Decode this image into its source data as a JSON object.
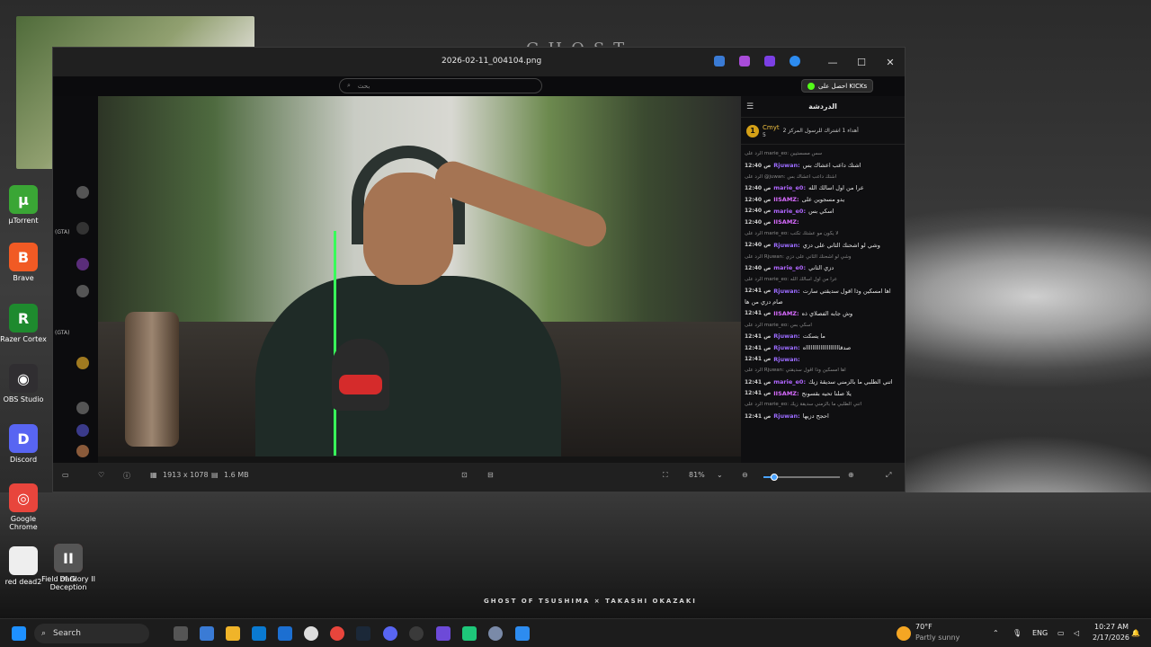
{
  "wallpaper": {
    "title": "GHOST",
    "credit": "GHOST OF TSUSHIMA × TAKASHI OKAZAKI"
  },
  "desktop_icons": [
    {
      "label": "µTorrent",
      "icon": "utorrent-icon",
      "color": "#3aa635",
      "glyph": "µ"
    },
    {
      "label": "Brave",
      "icon": "brave-icon",
      "color": "#f15a24",
      "glyph": "B"
    },
    {
      "label": "Razer Cortex",
      "icon": "razer-icon",
      "color": "#1e8a2e",
      "glyph": "R"
    },
    {
      "label": "OBS Studio",
      "icon": "obs-icon",
      "color": "#302e31",
      "glyph": "◉"
    },
    {
      "label": "Discord",
      "icon": "discord-icon",
      "color": "#5865f2",
      "glyph": "D"
    },
    {
      "label": "Google Chrome",
      "icon": "chrome-icon",
      "color": "#e8453c",
      "glyph": "◎"
    },
    {
      "label": "Dark Deception",
      "icon": "dark-deception-icon",
      "color": "#7a1010",
      "glyph": "☠"
    },
    {
      "label": "red dead2",
      "icon": "file-icon",
      "color": "#eeeeee",
      "glyph": ""
    },
    {
      "label": "Field of Glory II",
      "icon": "field-of-glory-icon",
      "color": "#555555",
      "glyph": "II"
    }
  ],
  "viewer": {
    "filename": "2026-02-11_004104.png",
    "dimensions": "1913 x 1078",
    "filesize": "1.6 MB",
    "zoom": "81%",
    "zoom_fraction": 0.14,
    "controls": {
      "minimize": "—",
      "maximize": "☐",
      "close": "✕"
    }
  },
  "stream": {
    "search_placeholder": "بحث",
    "kick_button": "احصل على KICKs",
    "sidebar_labels": [
      "(GTA)",
      "(GTA)"
    ]
  },
  "chat": {
    "title": "الدردشة",
    "pinned_user": "Cmyt",
    "pinned_count": "5",
    "pinned_badge": "1",
    "pinned_text": "أهداء 1 اشتراك للرسول المركز 2",
    "messages": [
      {
        "time": "",
        "user": "",
        "text": "الرد على marie_eo: سس مسستيين",
        "system": true
      },
      {
        "time": "12:40 ص",
        "user": "Rjuwan:",
        "text": "اشتك داعب اعشاك بس",
        "color": "#9b6bff"
      },
      {
        "time": "",
        "user": "",
        "text": "الرد على @juwan: اشتك داعب اعشاك بس",
        "system": true
      },
      {
        "time": "12:40 ص",
        "user": "marie_e0:",
        "text": "عرا من اول اسالك الله",
        "color": "#b066ff"
      },
      {
        "time": "12:40 ص",
        "user": "IISAMZ:",
        "text": "يدو مسجوين على",
        "color": "#d86bff"
      },
      {
        "time": "12:40 ص",
        "user": "marie_e0:",
        "text": "اسكي بس",
        "color": "#b066ff"
      },
      {
        "time": "12:40 ص",
        "user": "IISAMZ:",
        "text": "",
        "color": "#d86bff"
      },
      {
        "time": "",
        "user": "",
        "text": "الرد على marie_eo: لا يكون مو عشتك تكتب",
        "system": true
      },
      {
        "time": "12:40 ص",
        "user": "Rjuwan:",
        "text": "وشي لو اشحنك الثاني على دزي",
        "color": "#9b6bff"
      },
      {
        "time": "",
        "user": "",
        "text": "الرد على Rjuwan: وشي لو اشحنك الثاني على دزي",
        "system": true
      },
      {
        "time": "12:40 ص",
        "user": "marie_e0:",
        "text": "دزي الثاني",
        "color": "#b066ff"
      },
      {
        "time": "",
        "user": "",
        "text": "الرد على marie_eo: عرا من اول اسالك الله",
        "system": true
      },
      {
        "time": "12:41 ص",
        "user": "Rjuwan:",
        "text": "اها امسكين وذا اقول سديقتي سارت",
        "color": "#9b6bff"
      },
      {
        "time": "",
        "user": "",
        "text": "صام دزي من ها",
        "system": false
      },
      {
        "time": "12:41 ص",
        "user": "IISAMZ:",
        "text": "وش جابه الفصلاي ذه",
        "color": "#d86bff"
      },
      {
        "time": "",
        "user": "",
        "text": "الرد على marie_eo: اسكي بس",
        "system": true
      },
      {
        "time": "12:41 ص",
        "user": "Rjuwan:",
        "text": "ما يسكت",
        "color": "#9b6bff"
      },
      {
        "time": "12:41 ص",
        "user": "Rjuwan:",
        "text": "صدقاااااااااااااااااااااه",
        "color": "#9b6bff"
      },
      {
        "time": "12:41 ص",
        "user": "Rjuwan:",
        "text": "",
        "color": "#9b6bff"
      },
      {
        "time": "",
        "user": "",
        "text": "الرد على Rjuwan: اها امسكين وذا اقول سديقتي",
        "system": true
      },
      {
        "time": "12:41 ص",
        "user": "marie_e0:",
        "text": "اتني الطلبي ما بالزمني سديقة زيك",
        "color": "#b066ff"
      },
      {
        "time": "12:41 ص",
        "user": "IISAMZ:",
        "text": "يلا صلنا تحيه بقسونج",
        "color": "#d86bff"
      },
      {
        "time": "",
        "user": "",
        "text": "الرد على marie_eo: اتني الطلبي ما بالزمني سديقة زيك",
        "system": true
      },
      {
        "time": "12:41 ص",
        "user": "Rjuwan:",
        "text": "احجح دزيها",
        "color": "#9b6bff"
      }
    ]
  },
  "taskbar": {
    "search_label": "Search",
    "weather_temp": "70°F",
    "weather_desc": "Partly sunny",
    "lang": "ENG",
    "time": "10:27 AM",
    "date": "2/17/2026"
  }
}
